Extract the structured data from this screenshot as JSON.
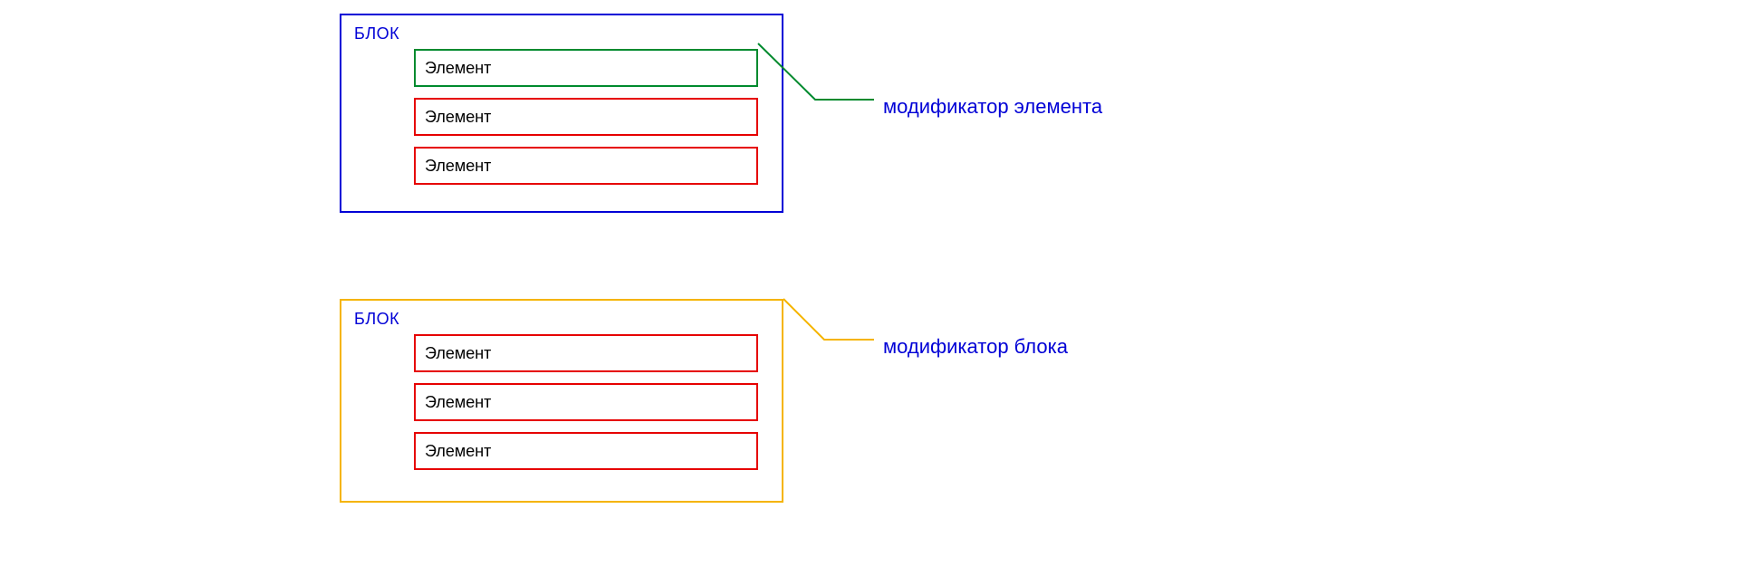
{
  "block1": {
    "title": "БЛОК",
    "elements": [
      "Элемент",
      "Элемент",
      "Элемент"
    ]
  },
  "block2": {
    "title": "БЛОК",
    "elements": [
      "Элемент",
      "Элемент",
      "Элемент"
    ]
  },
  "annotations": {
    "element_modifier": "модификатор элемента",
    "block_modifier": "модификатор блока"
  },
  "colors": {
    "blue": "#0000d6",
    "green": "#008a2e",
    "red": "#e60000",
    "orange": "#f5b400"
  }
}
